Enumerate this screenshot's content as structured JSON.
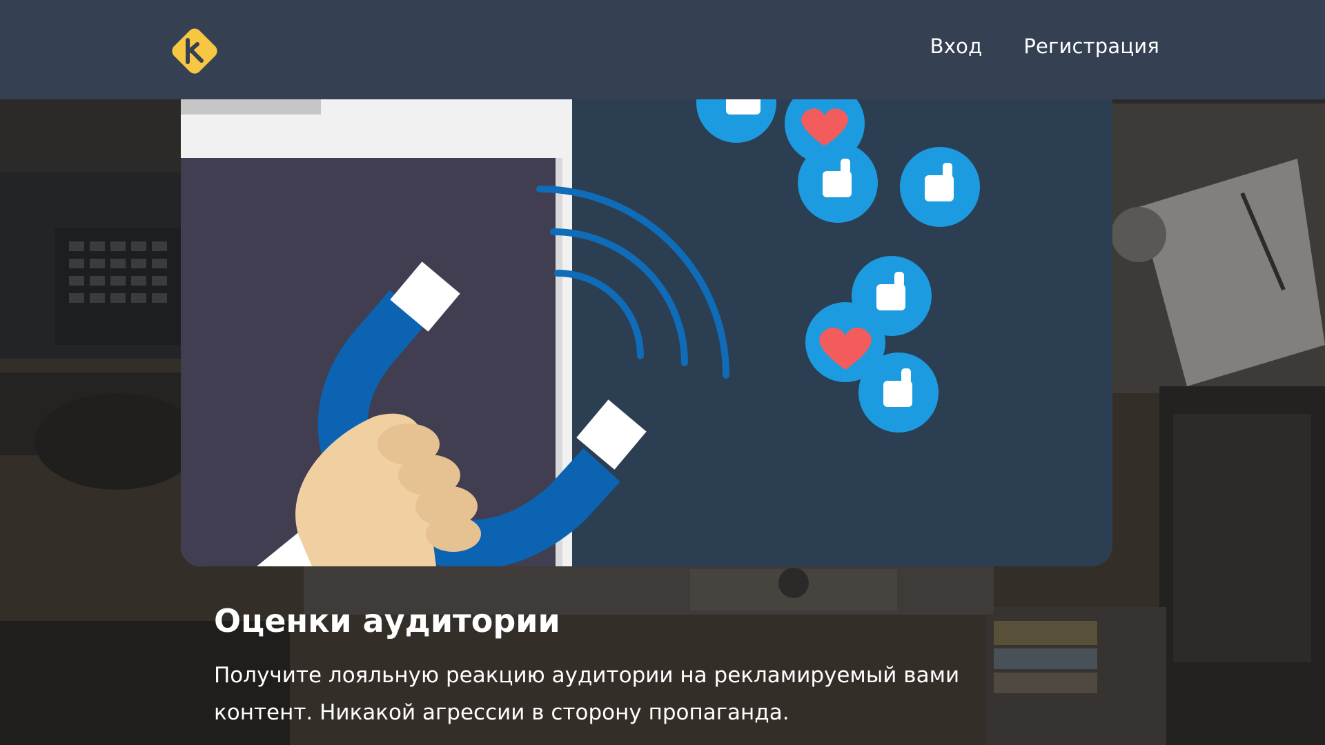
{
  "header": {
    "logo_icon": "brand-logo-icon",
    "nav": [
      {
        "label": "Вход"
      },
      {
        "label": "Регистрация"
      }
    ]
  },
  "hero": {
    "illustration_icon": "magnet-attracting-likes-illustration",
    "title": "Оценки аудитории",
    "description": "Получите лояльную реакцию аудитории на рекламируемый вами контент. Никакой агрессии в сторону пропаганда."
  },
  "colors": {
    "header_bg": "#354052",
    "logo_yellow": "#f7c744",
    "card_bg": "#2c3e51",
    "like_blue": "#1d9be0",
    "heart_red": "#f25c5c",
    "magnet_blue": "#0066b3"
  }
}
